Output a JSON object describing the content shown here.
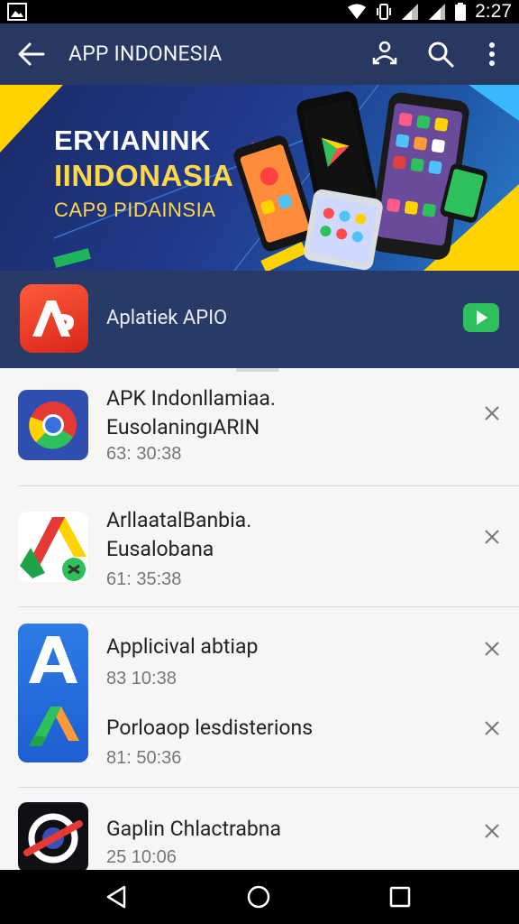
{
  "status": {
    "time": "2:27",
    "icons": [
      "image-icon",
      "wifi-icon",
      "vibrate-icon",
      "signal-icon",
      "signal-icon",
      "battery-icon"
    ]
  },
  "appbar": {
    "title": "APP INDONESIA",
    "actions": [
      "account-switch-icon",
      "search-icon",
      "more-vert-icon"
    ]
  },
  "banner": {
    "line1": "ERYIANINK",
    "line2": "IINDONASIA",
    "line3": "CAP9 PIDAINSIA"
  },
  "featured": {
    "name": "Aplatiek APIO",
    "icon_letter": "A",
    "play_icon": "play-icon"
  },
  "items": [
    {
      "title": "APK Indonllamiaa.",
      "subtitle": "EusolaningıARIN",
      "time": "63: 30:38",
      "icon": "chrome-icon"
    },
    {
      "title": "ArllaatalBanbia.",
      "subtitle": "Eusalobana",
      "time": "61: 35:38",
      "icon": "drive-icon"
    },
    {
      "title": "Applicival abtiap",
      "subtitle": "",
      "time": "83 10:38",
      "icon": "app-store-icon"
    },
    {
      "title": "Porloaop lesdisterions",
      "subtitle": "",
      "time": "81: 50:36",
      "icon": "drive-icon"
    },
    {
      "title": "Gaplin Chlactrabna",
      "subtitle": "",
      "time": "25 10:06",
      "icon": "blocked-icon"
    }
  ],
  "navbar": [
    "back-icon",
    "home-icon",
    "recents-icon"
  ],
  "colors": {
    "appbar": "#283862",
    "featured_bg": "#2a3a66",
    "list_bg": "#f7f6f4",
    "accent_green": "#2ec05a",
    "banner_yellow": "#ffd84a"
  }
}
